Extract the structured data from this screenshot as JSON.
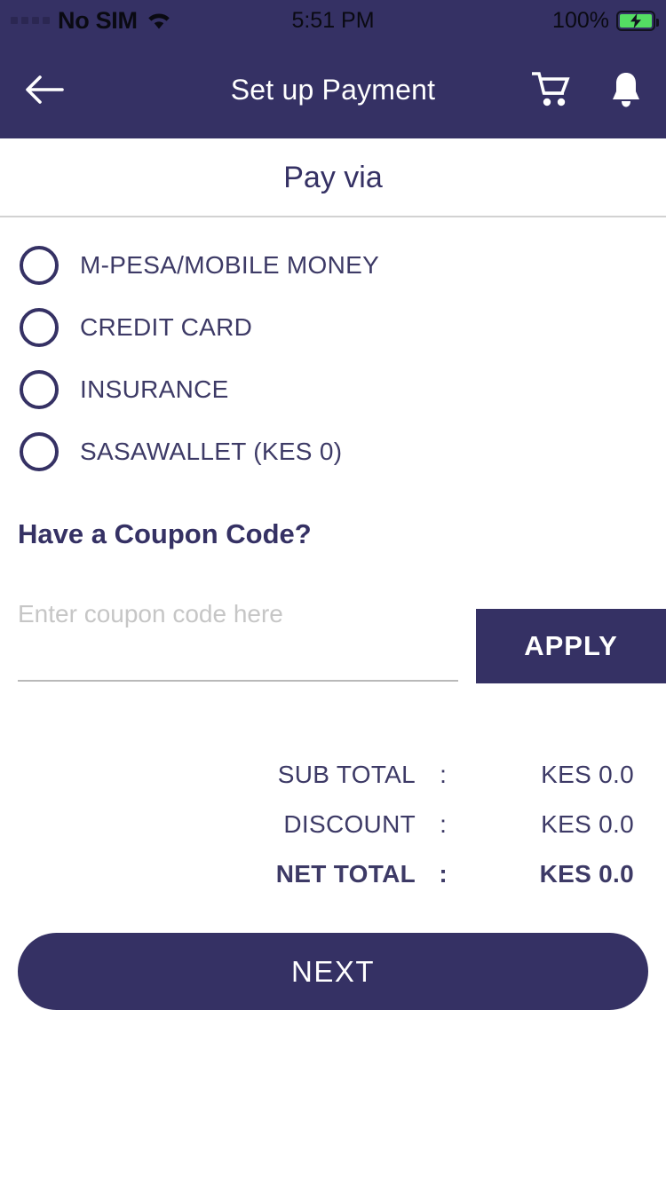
{
  "status_bar": {
    "carrier": "No SIM",
    "time": "5:51 PM",
    "battery_percent": "100%",
    "wifi_icon": "wifi-icon",
    "battery_icon": "battery-charging-icon",
    "signal_icon": "signal-dots-icon"
  },
  "header": {
    "title": "Set up Payment",
    "back_icon": "back-arrow-icon",
    "cart_icon": "shopping-cart-icon",
    "bell_icon": "notification-bell-icon"
  },
  "section": {
    "pay_via_title": "Pay via"
  },
  "payment_options": [
    {
      "label": "M-PESA/MOBILE MONEY",
      "selected": false
    },
    {
      "label": "CREDIT CARD",
      "selected": false
    },
    {
      "label": "INSURANCE",
      "selected": false
    },
    {
      "label": "SASAWALLET (KES 0)",
      "selected": false
    }
  ],
  "coupon": {
    "title": "Have a Coupon Code?",
    "input_value": "",
    "input_placeholder": "Enter coupon code here",
    "apply_label": "APPLY"
  },
  "totals": {
    "colon": ":",
    "rows": [
      {
        "label": "SUB TOTAL",
        "value": "KES 0.0",
        "bold": false
      },
      {
        "label": "DISCOUNT",
        "value": "KES 0.0",
        "bold": false
      },
      {
        "label": "NET TOTAL",
        "value": "KES 0.0",
        "bold": true
      }
    ]
  },
  "footer": {
    "next_label": "NEXT"
  },
  "colors": {
    "brand_navy": "#353164",
    "text_navy": "#3d3a66",
    "divider": "#d2d2d2",
    "placeholder": "#c6c6c6",
    "battery_green": "#54dd63",
    "background": "#ffffff"
  }
}
